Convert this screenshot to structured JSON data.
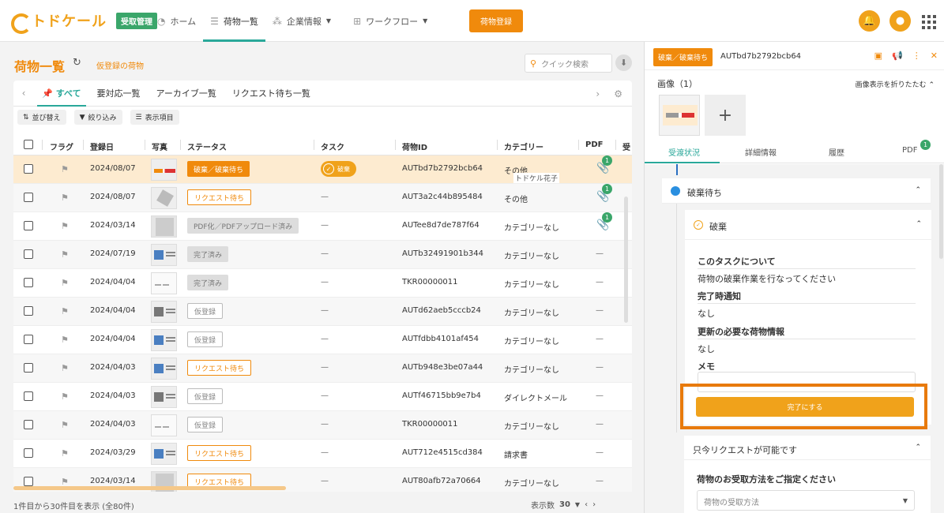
{
  "header": {
    "logo_text": "トドケール",
    "app_badge": "受取管理",
    "nav": [
      {
        "label": "ホーム",
        "icon": "dashboard-icon"
      },
      {
        "label": "荷物一覧",
        "icon": "list-icon"
      },
      {
        "label": "企業情報",
        "icon": "org-icon"
      },
      {
        "label": "ワークフロー",
        "icon": "workflow-icon"
      }
    ],
    "register_button": "荷物登録"
  },
  "list": {
    "title": "荷物一覧",
    "provisional_link": "仮登録の荷物",
    "search_placeholder": "クイック検索",
    "tabs": [
      "すべて",
      "要対応一覧",
      "アーカイブ一覧",
      "リクエスト待ち一覧"
    ],
    "tools": [
      "並び替え",
      "絞り込み",
      "表示項目"
    ],
    "columns": [
      "フラグ",
      "登録日",
      "写真",
      "ステータス",
      "タスク",
      "荷物ID",
      "カテゴリー",
      "PDF",
      "受"
    ],
    "tooltip": "トドケル花子",
    "task_label": "破棄",
    "rows": [
      {
        "date": "2024/08/07",
        "thumb": "t-red",
        "status": "破棄／破棄待ち",
        "status_style": "st-orange",
        "task": "破棄",
        "id": "AUTbd7b2792bcb64",
        "category": "その他",
        "pdf": "1",
        "selected": true
      },
      {
        "date": "2024/08/07",
        "thumb": "t-cube",
        "status": "リクエスト待ち",
        "status_style": "st-outline",
        "task": "—",
        "id": "AUT3a2c44b895484",
        "category": "その他",
        "pdf": "1"
      },
      {
        "date": "2024/03/14",
        "thumb": "t-paper",
        "status": "PDF化／PDFアップロード済み",
        "status_style": "st-gray",
        "task": "—",
        "id": "AUTee8d7de787f64",
        "category": "カテゴリーなし",
        "pdf": "1"
      },
      {
        "date": "2024/07/19",
        "thumb": "t-blue",
        "status": "完了済み",
        "status_style": "st-gray",
        "task": "—",
        "id": "AUTb32491901b344",
        "category": "カテゴリーなし",
        "pdf": "—"
      },
      {
        "date": "2024/04/04",
        "thumb": "t-small",
        "status": "完了済み",
        "status_style": "st-gray",
        "task": "—",
        "id": "TKR00000011",
        "category": "カテゴリーなし",
        "pdf": "—"
      },
      {
        "date": "2024/04/04",
        "thumb": "t-gray",
        "status": "仮登録",
        "status_style": "st-gray-outline",
        "task": "—",
        "id": "AUTd62aeb5cccb24",
        "category": "カテゴリーなし",
        "pdf": "—"
      },
      {
        "date": "2024/04/04",
        "thumb": "t-blue",
        "status": "仮登録",
        "status_style": "st-gray-outline",
        "task": "—",
        "id": "AUTfdbb4101af454",
        "category": "カテゴリーなし",
        "pdf": "—"
      },
      {
        "date": "2024/04/03",
        "thumb": "t-blue",
        "status": "リクエスト待ち",
        "status_style": "st-outline",
        "task": "—",
        "id": "AUTb948e3be07a44",
        "category": "カテゴリーなし",
        "pdf": "—"
      },
      {
        "date": "2024/04/03",
        "thumb": "t-gray",
        "status": "仮登録",
        "status_style": "st-gray-outline",
        "task": "—",
        "id": "AUTf46715bb9e7b4",
        "category": "ダイレクトメール",
        "pdf": "—"
      },
      {
        "date": "2024/04/03",
        "thumb": "t-small",
        "status": "仮登録",
        "status_style": "st-gray-outline",
        "task": "—",
        "id": "TKR00000011",
        "category": "カテゴリーなし",
        "pdf": "—"
      },
      {
        "date": "2024/03/29",
        "thumb": "t-blue",
        "status": "リクエスト待ち",
        "status_style": "st-outline",
        "task": "—",
        "id": "AUT712e4515cd384",
        "category": "請求書",
        "pdf": "—"
      },
      {
        "date": "2024/03/14",
        "thumb": "t-paper",
        "status": "リクエスト待ち",
        "status_style": "st-outline",
        "task": "—",
        "id": "AUT80afb72a70664",
        "category": "カテゴリーなし",
        "pdf": "—"
      }
    ],
    "footer_count": "1件目から30件目を表示 (全80件)",
    "page_size_label": "表示数",
    "page_size": "30"
  },
  "detail": {
    "status": "破棄／破棄待ち",
    "id": "AUTbd7b2792bcb64",
    "images_title": "画像（1）",
    "images_toggle": "画像表示を折りたたむ",
    "tabs": [
      "受渡状況",
      "詳細情報",
      "履歴",
      "PDF"
    ],
    "pdf_count": "1",
    "stage": "破棄待ち",
    "task_title": "破棄",
    "about_label": "このタスクについて",
    "about_value": "荷物の破棄作業を行なってください",
    "notify_label": "完了時通知",
    "notify_value": "なし",
    "update_label": "更新の必要な荷物情報",
    "update_value": "なし",
    "memo_label": "メモ",
    "complete_button": "完了にする",
    "request_title": "只今リクエストが可能です",
    "request_question": "荷物のお受取方法をご指定ください",
    "request_placeholder": "荷物の受取方法"
  },
  "colors": {
    "accent": "#f08a0c",
    "teal": "#2aa89a",
    "green": "#3aa66a"
  }
}
